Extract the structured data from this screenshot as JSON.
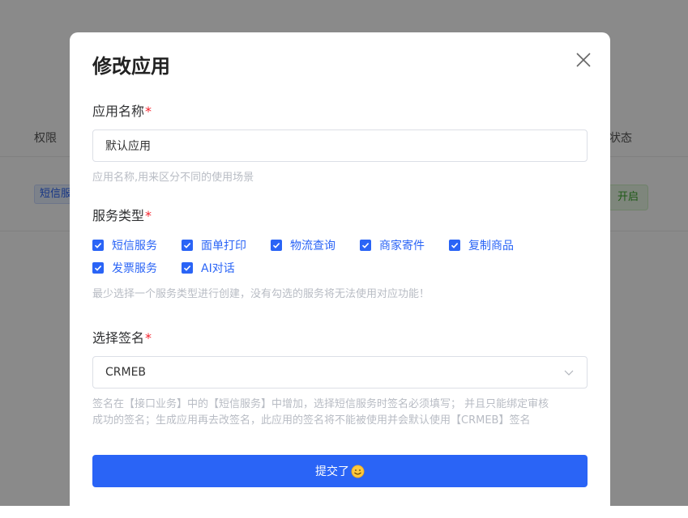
{
  "background": {
    "col_permission": "权限",
    "col_status": "状态",
    "row_tag": "短信服务",
    "row_status": "开启"
  },
  "modal": {
    "title": "修改应用",
    "name_field": {
      "label": "应用名称",
      "required_mark": "*",
      "value": "默认应用",
      "hint": "应用名称,用来区分不同的使用场景"
    },
    "service_field": {
      "label": "服务类型",
      "required_mark": "*",
      "options": [
        {
          "label": "短信服务",
          "checked": true
        },
        {
          "label": "面单打印",
          "checked": true
        },
        {
          "label": "物流查询",
          "checked": true
        },
        {
          "label": "商家寄件",
          "checked": true
        },
        {
          "label": "复制商品",
          "checked": true
        },
        {
          "label": "发票服务",
          "checked": true
        },
        {
          "label": "AI对话",
          "checked": true
        }
      ],
      "hint": "最少选择一个服务类型进行创建，没有勾选的服务将无法使用对应功能！"
    },
    "sign_field": {
      "label": "选择签名",
      "required_mark": "*",
      "value": "CRMEB",
      "hint_line1": "签名在【接口业务】中的【短信服务】中增加，选择短信服务时签名必须填写； 并且只能绑定审核",
      "hint_line2": "成功的签名；生成应用再去改签名，此应用的签名将不能被使用并会默认使用【CRMEB】签名"
    },
    "submit_label": "提交了"
  },
  "colors": {
    "primary": "#2a64f6",
    "required": "#f5222d",
    "hint": "#b8bcc4"
  },
  "icons": {
    "close": "close-icon",
    "chevron": "chevron-down-icon",
    "check": "check-icon",
    "smile": "smile-emoji-icon"
  }
}
